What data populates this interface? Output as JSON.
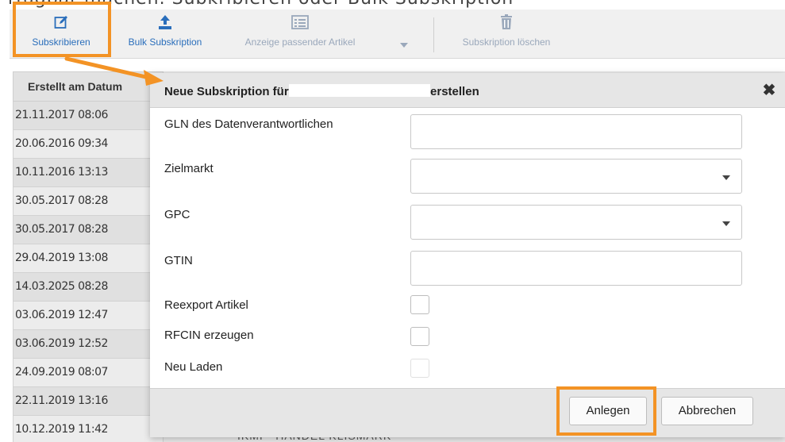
{
  "top_caption": "rfügbar machen. Subkribieren oder Bulk Subskription",
  "toolbar": {
    "subscribe_label": "Subskribieren",
    "bulk_label": "Bulk Subskription",
    "matching_label": "Anzeige passender Artikel",
    "delete_label": "Subskription löschen"
  },
  "grid": {
    "header": "Erstellt am Datum",
    "rows": [
      "21.11.2017 08:06",
      "20.06.2016 09:34",
      "10.11.2016 13:13",
      "30.05.2017 08:28",
      "30.05.2017 08:28",
      "29.04.2019 13:08",
      "14.03.2025 08:28",
      "03.06.2019 12:47",
      "03.06.2019 12:52",
      "24.09.2019 08:07",
      "22.11.2019 13:16",
      "10.12.2019 11:42"
    ],
    "bottom_text": "IKMI - HANDEL KLISMARK"
  },
  "modal": {
    "title_prefix": "Neue Subskription für",
    "title_suffix": "erstellen",
    "close_symbol": "✖",
    "fields": {
      "gln_label": "GLN des Datenverantwortlichen",
      "gln_value": "",
      "zielmarkt_label": "Zielmarkt",
      "zielmarkt_value": "",
      "gpc_label": "GPC",
      "gpc_value": "",
      "gtin_label": "GTIN",
      "gtin_value": "",
      "reexport_label": "Reexport Artikel",
      "rfcin_label": "RFCIN erzeugen",
      "neuladen_label": "Neu Laden"
    },
    "buttons": {
      "create": "Anlegen",
      "cancel": "Abbrechen"
    }
  },
  "colors": {
    "highlight": "#f39325",
    "link_blue": "#2a6ebb",
    "disabled_blue": "#9aa8bb"
  }
}
